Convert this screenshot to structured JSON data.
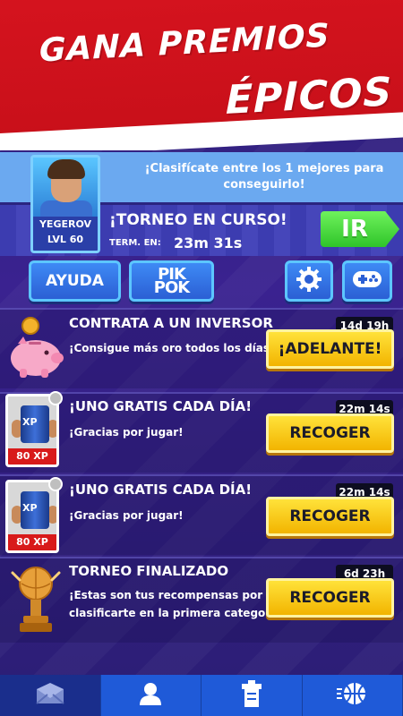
{
  "banner": {
    "line1": "GANA PREMIOS",
    "line2": "ÉPICOS"
  },
  "tournament": {
    "info_line1": "¡Clasifícate entre los 1 mejores para",
    "info_line2": "conseguirlo!",
    "player_name": "YEGEROV",
    "player_level": "LVL 60",
    "status": "¡TORNEO EN CURSO!",
    "term_label": "TERM. EN:",
    "term_time": "23m 31s",
    "go_button": "IR"
  },
  "toolbar": {
    "help_label": "AYUDA",
    "pik_line1": "PIK",
    "pik_line2": "POK"
  },
  "rows": [
    {
      "title": "CONTRATA A UN INVERSOR",
      "subtitle_line1": "¡Consigue más oro todos los días!",
      "subtitle_line2": "",
      "timer": "14d 19h",
      "button": "¡ADELANTE!"
    },
    {
      "title": "¡UNO GRATIS CADA DÍA!",
      "subtitle_line1": "¡Gracias por jugar!",
      "subtitle_line2": "",
      "timer": "22m 14s",
      "button": "RECOGER",
      "card_label": "80 XP",
      "card_text": "XP"
    },
    {
      "title": "¡UNO GRATIS CADA DÍA!",
      "subtitle_line1": "¡Gracias por jugar!",
      "subtitle_line2": "",
      "timer": "22m 14s",
      "button": "RECOGER",
      "card_label": "80 XP",
      "card_text": "XP"
    },
    {
      "title": "TORNEO FINALIZADO",
      "subtitle_line1": "¡Estas son tus recompensas por",
      "subtitle_line2": "clasificarte en la primera categoría!",
      "timer": "6d 23h",
      "button": "RECOGER"
    }
  ],
  "nav": {
    "tabs": [
      {
        "icon": "mail-icon",
        "active": true
      },
      {
        "icon": "user-icon",
        "active": false
      },
      {
        "icon": "trophy-stand-icon",
        "active": false
      },
      {
        "icon": "basketball-icon",
        "active": false
      }
    ]
  },
  "colors": {
    "banner_red": "#d8141f",
    "go_green": "#2fc42a",
    "button_yellow": "#f2b400",
    "nav_blue": "#1f5ad8"
  }
}
